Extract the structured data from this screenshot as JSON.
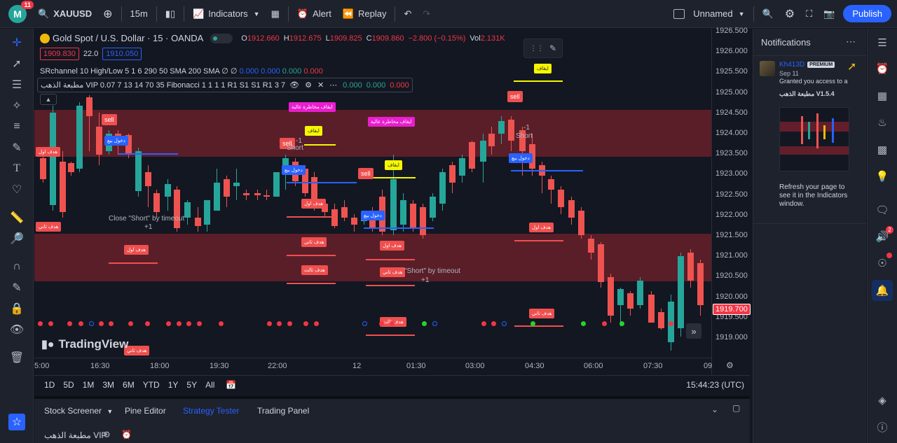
{
  "topbar": {
    "badge_count": "11",
    "symbol": "XAUUSD",
    "interval": "15m",
    "indicators": "Indicators",
    "alert": "Alert",
    "replay": "Replay",
    "layout_name": "Unnamed",
    "publish": "Publish"
  },
  "legend": {
    "title": "Gold Spot / U.S. Dollar · 15 · OANDA",
    "open_label": "O",
    "open": "1912.660",
    "high_label": "H",
    "high": "1912.675",
    "low_label": "L",
    "low": "1909.825",
    "close_label": "C",
    "close": "1909.860",
    "change": "−2.800 (−0.15%)",
    "vol_label": "Vol",
    "vol": "2.131K",
    "bid": "1909.830",
    "spread": "22.0",
    "ask": "1910.050",
    "ind1": "SRchannel 10 High/Low 5 1 6 290 50 SMA 200 SMA ∅ ∅",
    "ind1_vals": [
      "0.000",
      "0.000",
      "0.000",
      "0.000"
    ],
    "ind2": "مطبعة الذهب VIP 0.07 7 13 14 70 35 Fibonacci 1 1 1 1 R1 S1 S1 R1 3 7",
    "ind2_vals": [
      "0.000",
      "0.000",
      "0.000"
    ]
  },
  "price_axis": {
    "labels": [
      "1926.500",
      "1926.000",
      "1925.500",
      "1925.000",
      "1924.500",
      "1924.000",
      "1923.500",
      "1923.000",
      "1922.500",
      "1922.000",
      "1921.500",
      "1921.000",
      "1920.500",
      "1920.000",
      "1919.500",
      "1919.000"
    ],
    "current": "1919.700"
  },
  "time_axis": {
    "labels": [
      "5:00",
      "16:30",
      "18:00",
      "19:30",
      "22:00",
      "12",
      "01:30",
      "03:00",
      "04:30",
      "06:00",
      "07:30",
      "09"
    ]
  },
  "ranges": [
    "1D",
    "5D",
    "1M",
    "3M",
    "6M",
    "YTD",
    "1Y",
    "5Y",
    "All"
  ],
  "clock": "15:44:23 (UTC)",
  "bottom_tabs": [
    "Stock Screener",
    "Pine Editor",
    "Strategy Tester",
    "Trading Panel"
  ],
  "bottom_script": "مطبعة الذهب VIP",
  "watermark": "TradingView",
  "notifications": {
    "title": "Notifications",
    "user": "Kh413D",
    "badge": "PREMIUM",
    "date": "Sep 11",
    "message": "Granted you access to a",
    "script": "مطبعة الذهب V1.5.4",
    "refresh": "Refresh your page to see it in the Indicators window."
  },
  "chart_labels": {
    "sell": "sell",
    "entry_sell": "دخول بيع",
    "stop": "ايقاف",
    "high_risk_stop": "ايقاف مخاطرة عالية",
    "tp1": "هدف اول",
    "tp2": "هدف ثاني",
    "tp3": "هدف ثالث",
    "short": "Short",
    "minus_one": "-1",
    "close_short": "Close \"Short\" by timeout",
    "plus_one": "+1",
    "close_short_partial": "\"Short\" by timeout"
  },
  "colors": {
    "up": "#26a69a",
    "down": "#ef5350",
    "accent": "#2962ff",
    "zone": "#b22833"
  }
}
